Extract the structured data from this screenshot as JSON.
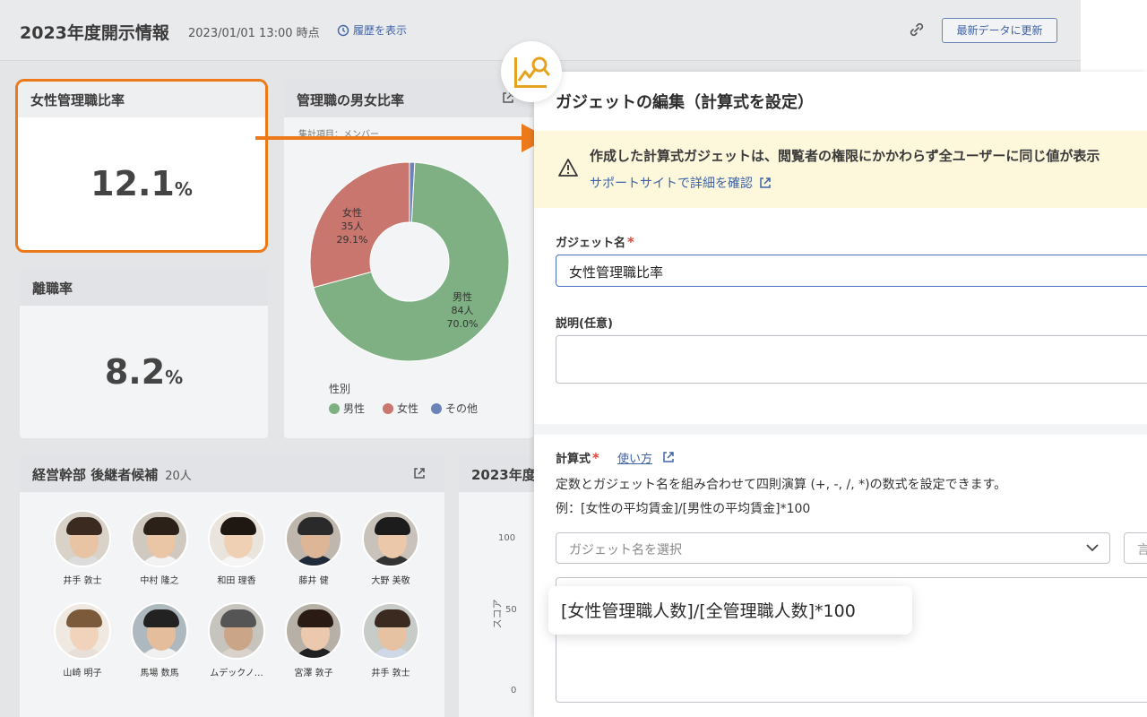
{
  "dashboard": {
    "title": "2023年度開示情報",
    "timestamp": "2023/01/01 13:00 時点",
    "history_link": "履歴を表示",
    "refresh_button": "最新データに更新"
  },
  "cards": {
    "female_manager": {
      "title": "女性管理職比率",
      "value": "12.1",
      "unit": "%"
    },
    "turnover": {
      "title": "離職率",
      "value": "8.2",
      "unit": "%"
    },
    "gender_ratio": {
      "title": "管理職の男女比率",
      "subtitle": "集計項目：メンバー",
      "legend_title": "性別",
      "legend": [
        "男性",
        "女性",
        "その他"
      ],
      "label_female": [
        "女性",
        "35人",
        "29.1%"
      ],
      "label_male": [
        "男性",
        "84人",
        "70.0%"
      ]
    },
    "successors": {
      "title": "経営幹部 後継者候補",
      "count": "20人",
      "people": [
        "井手 敦士",
        "中村 隆之",
        "和田 理香",
        "藤井 健",
        "大野 美敬",
        "山崎 明子",
        "馬場 数馬",
        "ムデックノ…",
        "宮澤 敦子",
        "井手 敦士"
      ]
    },
    "score": {
      "title": "2023年度",
      "ylabel": "スコア",
      "ticks": [
        "100",
        "50",
        "0"
      ]
    }
  },
  "chart_data": {
    "type": "pie",
    "title": "管理職の男女比率",
    "categories": [
      "男性",
      "女性",
      "その他"
    ],
    "values": [
      84,
      35,
      1
    ],
    "percent_labels": [
      "70.0%",
      "29.1%",
      ""
    ],
    "colors": [
      "#7fb083",
      "#c9766f",
      "#6c83b8"
    ],
    "legend_placement": "bottom-left"
  },
  "modal": {
    "title": "ガジェットの編集（計算式を設定）",
    "warning_text": "作成した計算式ガジェットは、閲覧者の権限にかかわらず全ユーザーに同じ値が表示",
    "warning_link": "サポートサイトで詳細を確認",
    "name_label": "ガジェット名",
    "name_required": "*",
    "name_value": "女性管理職比率",
    "desc_label": "説明(任意)",
    "formula_label": "計算式",
    "formula_required": "*",
    "help_link": "使い方",
    "formula_desc1": "定数とガジェット名を組み合わせて四則演算 (+, -, /, *)の数式を設定できます。",
    "formula_desc2": "例：[女性の平均賃金]/[男性の平均賃金]*100",
    "select_placeholder": "ガジェット名を選択",
    "side_button": "言",
    "formula_value": "[女性管理職人数]/[全管理職人数]*100"
  },
  "colors": {
    "accent_orange": "#ec7a1b",
    "link_blue": "#3f63a8",
    "warning_bg": "#fdf7dc"
  }
}
